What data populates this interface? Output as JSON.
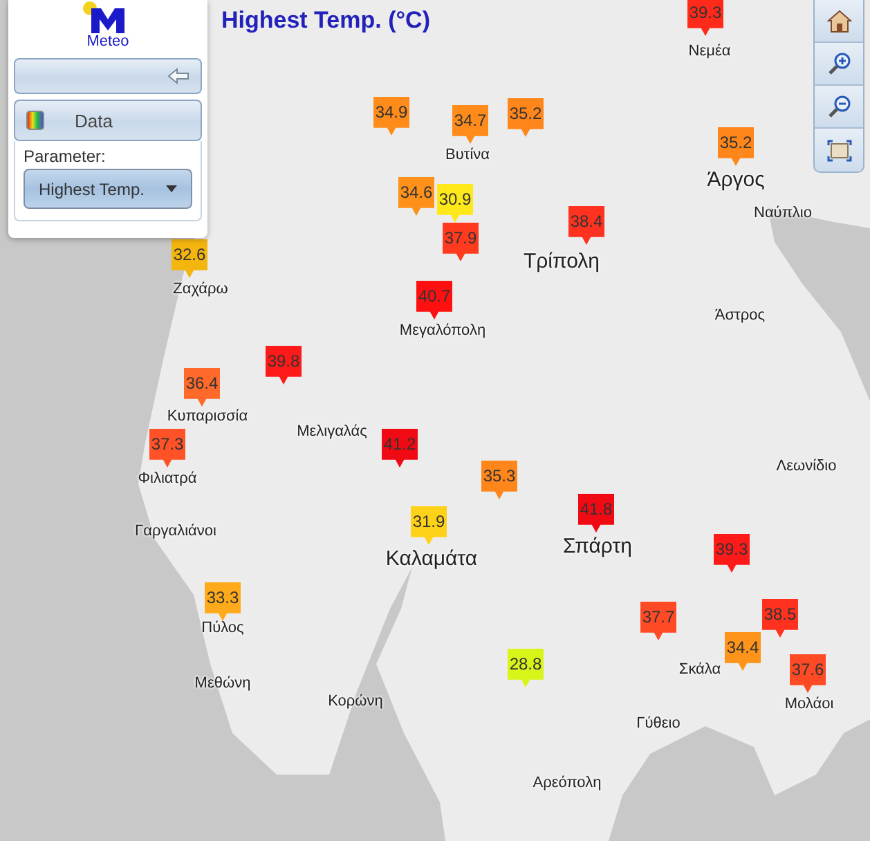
{
  "panel": {
    "logo": "Meteo",
    "data_button": "Data",
    "parameter_label": "Parameter:",
    "parameter_value": "Highest Temp."
  },
  "title": "Highest Temp. (°C)",
  "places": [
    {
      "name": "Νεμέα",
      "big": false
    },
    {
      "name": "Βυτίνα",
      "big": false
    },
    {
      "name": "Άργος",
      "big": true
    },
    {
      "name": "Ναύπλιο",
      "big": false
    },
    {
      "name": "Τρίπολη",
      "big": true
    },
    {
      "name": "Ζαχάρω",
      "big": false
    },
    {
      "name": "Μεγαλόπολη",
      "big": false
    },
    {
      "name": "Άστρος",
      "big": false
    },
    {
      "name": "Κυπαρισσία",
      "big": false
    },
    {
      "name": "Μελιγαλάς",
      "big": false
    },
    {
      "name": "Λεωνίδιο",
      "big": false
    },
    {
      "name": "Φιλιατρά",
      "big": false
    },
    {
      "name": "Σπάρτη",
      "big": true
    },
    {
      "name": "Γαργαλιάνοι",
      "big": false
    },
    {
      "name": "Καλαμάτα",
      "big": true
    },
    {
      "name": "Πύλος",
      "big": false
    },
    {
      "name": "Σκάλα",
      "big": false
    },
    {
      "name": "Μεθώνη",
      "big": false
    },
    {
      "name": "Μολάοι",
      "big": false
    },
    {
      "name": "Κορώνη",
      "big": false
    },
    {
      "name": "Γύθειο",
      "big": false
    },
    {
      "name": "Αρεόπολη",
      "big": false
    }
  ],
  "markers": [
    {
      "value": "39.3",
      "color": "#ff2a1a"
    },
    {
      "value": "34.9",
      "color": "#ff8c1a"
    },
    {
      "value": "34.7",
      "color": "#ff8c1a"
    },
    {
      "value": "35.2",
      "color": "#ff861a"
    },
    {
      "value": "35.2",
      "color": "#ff861a"
    },
    {
      "value": "34.6",
      "color": "#ff901a"
    },
    {
      "value": "30.9",
      "color": "#ffe81a"
    },
    {
      "value": "37.9",
      "color": "#ff3a1f"
    },
    {
      "value": "38.4",
      "color": "#ff321f"
    },
    {
      "value": "32.6",
      "color": "#f5b50f"
    },
    {
      "value": "40.7",
      "color": "#ff1010"
    },
    {
      "value": "39.8",
      "color": "#ff1a1a"
    },
    {
      "value": "36.4",
      "color": "#ff6a2a"
    },
    {
      "value": "37.3",
      "color": "#ff5226"
    },
    {
      "value": "41.2",
      "color": "#f00a14"
    },
    {
      "value": "35.3",
      "color": "#ff861a"
    },
    {
      "value": "41.8",
      "color": "#f00a14"
    },
    {
      "value": "31.9",
      "color": "#ffd21a"
    },
    {
      "value": "39.3",
      "color": "#ff1a1a"
    },
    {
      "value": "33.3",
      "color": "#ffaa1a"
    },
    {
      "value": "38.5",
      "color": "#ff321f"
    },
    {
      "value": "37.7",
      "color": "#ff4a26"
    },
    {
      "value": "34.4",
      "color": "#ff941a"
    },
    {
      "value": "28.8",
      "color": "#d8f51a"
    },
    {
      "value": "37.6",
      "color": "#ff4a26"
    }
  ]
}
